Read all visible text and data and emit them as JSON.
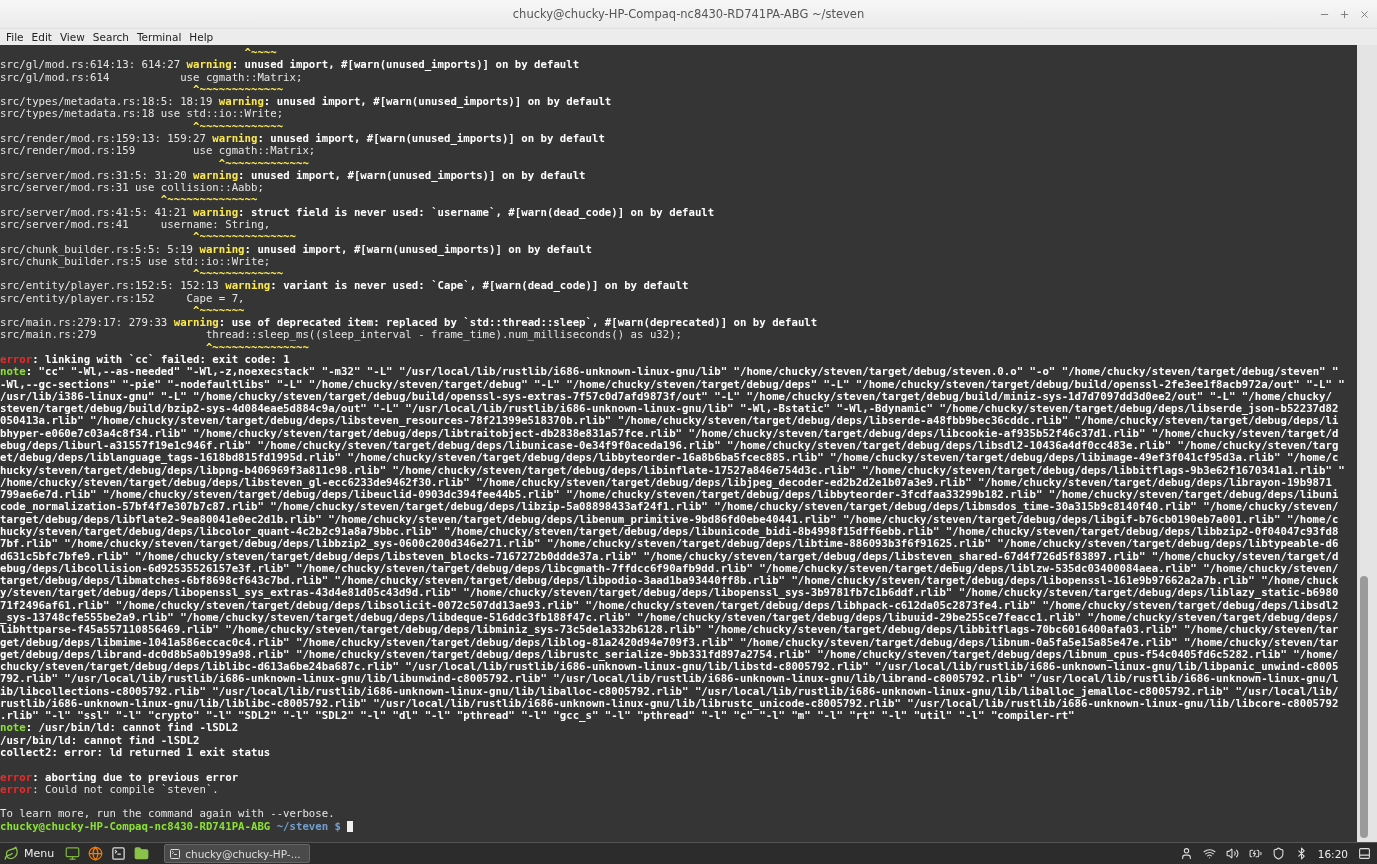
{
  "window": {
    "title": "chucky@chucky-HP-Compaq-nc8430-RD741PA-ABG ~/steven"
  },
  "menu_bar": [
    "File",
    "Edit",
    "View",
    "Search",
    "Terminal",
    "Help"
  ],
  "terminal": {
    "lines": [
      {
        "kind": "text",
        "segments": [
          {
            "kind": "caret",
            "text": "                                      ^~~~~"
          }
        ]
      },
      {
        "kind": "text",
        "segments": [
          {
            "kind": "plain",
            "text": "src/gl/mod.rs:614:13: 614:27 "
          },
          {
            "kind": "warning",
            "text": "warning"
          },
          {
            "kind": "bold",
            "text": ": unused import, #[warn(unused_imports)] on by default"
          }
        ]
      },
      {
        "kind": "text",
        "segments": [
          {
            "kind": "plain",
            "text": "src/gl/mod.rs:614           use cgmath::Matrix;"
          }
        ]
      },
      {
        "kind": "text",
        "segments": [
          {
            "kind": "caret",
            "text": "                              ^~~~~~~~~~~~~~"
          }
        ]
      },
      {
        "kind": "text",
        "segments": [
          {
            "kind": "plain",
            "text": "src/types/metadata.rs:18:5: 18:19 "
          },
          {
            "kind": "warning",
            "text": "warning"
          },
          {
            "kind": "bold",
            "text": ": unused import, #[warn(unused_imports)] on by default"
          }
        ]
      },
      {
        "kind": "text",
        "segments": [
          {
            "kind": "plain",
            "text": "src/types/metadata.rs:18 use std::io::Write;"
          }
        ]
      },
      {
        "kind": "text",
        "segments": [
          {
            "kind": "caret",
            "text": "                              ^~~~~~~~~~~~~~"
          }
        ]
      },
      {
        "kind": "text",
        "segments": [
          {
            "kind": "plain",
            "text": "src/render/mod.rs:159:13: 159:27 "
          },
          {
            "kind": "warning",
            "text": "warning"
          },
          {
            "kind": "bold",
            "text": ": unused import, #[warn(unused_imports)] on by default"
          }
        ]
      },
      {
        "kind": "text",
        "segments": [
          {
            "kind": "plain",
            "text": "src/render/mod.rs:159         use cgmath::Matrix;"
          }
        ]
      },
      {
        "kind": "text",
        "segments": [
          {
            "kind": "caret",
            "text": "                                  ^~~~~~~~~~~~~~"
          }
        ]
      },
      {
        "kind": "text",
        "segments": [
          {
            "kind": "plain",
            "text": "src/server/mod.rs:31:5: 31:20 "
          },
          {
            "kind": "warning",
            "text": "warning"
          },
          {
            "kind": "bold",
            "text": ": unused import, #[warn(unused_imports)] on by default"
          }
        ]
      },
      {
        "kind": "text",
        "segments": [
          {
            "kind": "plain",
            "text": "src/server/mod.rs:31 use collision::Aabb;"
          }
        ]
      },
      {
        "kind": "text",
        "segments": [
          {
            "kind": "caret",
            "text": "                         ^~~~~~~~~~~~~~~"
          }
        ]
      },
      {
        "kind": "text",
        "segments": [
          {
            "kind": "plain",
            "text": "src/server/mod.rs:41:5: 41:21 "
          },
          {
            "kind": "warning",
            "text": "warning"
          },
          {
            "kind": "bold",
            "text": ": struct field is never used: `username`, #[warn(dead_code)] on by default"
          }
        ]
      },
      {
        "kind": "text",
        "segments": [
          {
            "kind": "plain",
            "text": "src/server/mod.rs:41     username: String,"
          }
        ]
      },
      {
        "kind": "text",
        "segments": [
          {
            "kind": "caret",
            "text": "                              ^~~~~~~~~~~~~~~~"
          }
        ]
      },
      {
        "kind": "text",
        "segments": [
          {
            "kind": "plain",
            "text": "src/chunk_builder.rs:5:5: 5:19 "
          },
          {
            "kind": "warning",
            "text": "warning"
          },
          {
            "kind": "bold",
            "text": ": unused import, #[warn(unused_imports)] on by default"
          }
        ]
      },
      {
        "kind": "text",
        "segments": [
          {
            "kind": "plain",
            "text": "src/chunk_builder.rs:5 use std::io::Write;"
          }
        ]
      },
      {
        "kind": "text",
        "segments": [
          {
            "kind": "caret",
            "text": "                              ^~~~~~~~~~~~~~"
          }
        ]
      },
      {
        "kind": "text",
        "segments": [
          {
            "kind": "plain",
            "text": "src/entity/player.rs:152:5: 152:13 "
          },
          {
            "kind": "warning",
            "text": "warning"
          },
          {
            "kind": "bold",
            "text": ": variant is never used: `Cape`, #[warn(dead_code)] on by default"
          }
        ]
      },
      {
        "kind": "text",
        "segments": [
          {
            "kind": "plain",
            "text": "src/entity/player.rs:152     Cape = 7,"
          }
        ]
      },
      {
        "kind": "text",
        "segments": [
          {
            "kind": "caret",
            "text": "                              ^~~~~~~~"
          }
        ]
      },
      {
        "kind": "text",
        "segments": [
          {
            "kind": "plain",
            "text": "src/main.rs:279:17: 279:33 "
          },
          {
            "kind": "warning",
            "text": "warning"
          },
          {
            "kind": "bold",
            "text": ": use of deprecated item: replaced by `std::thread::sleep`, #[warn(deprecated)] on by default"
          }
        ]
      },
      {
        "kind": "text",
        "segments": [
          {
            "kind": "plain",
            "text": "src/main.rs:279                 thread::sleep_ms((sleep_interval - frame_time).num_milliseconds() as u32);"
          }
        ]
      },
      {
        "kind": "text",
        "segments": [
          {
            "kind": "caret",
            "text": "                                ^~~~~~~~~~~~~~~~"
          }
        ]
      },
      {
        "kind": "text",
        "segments": [
          {
            "kind": "error",
            "text": "error"
          },
          {
            "kind": "bold",
            "text": ": linking with `cc` failed: exit code: 1"
          }
        ]
      },
      {
        "kind": "text",
        "segments": [
          {
            "kind": "note",
            "text": "note"
          },
          {
            "kind": "bold",
            "text": ": \"cc\" \"-Wl,--as-needed\" \"-Wl,-z,noexecstack\" \"-m32\" \"-L\" \"/usr/local/lib/rustlib/i686-unknown-linux-gnu/lib\" \"/home/chucky/steven/target/debug/steven.0.o\" \"-o\" \"/home/chucky/steven/target/debug/steven\" \""
          }
        ]
      },
      {
        "kind": "text",
        "segments": [
          {
            "kind": "bold",
            "text": "-Wl,--gc-sections\" \"-pie\" \"-nodefaultlibs\" \"-L\" \"/home/chucky/steven/target/debug\" \"-L\" \"/home/chucky/steven/target/debug/deps\" \"-L\" \"/home/chucky/steven/target/debug/build/openssl-2fe3ee1f8acb972a/out\" \"-L\" \""
          }
        ]
      },
      {
        "kind": "text",
        "segments": [
          {
            "kind": "bold",
            "text": "/usr/lib/i386-linux-gnu\" \"-L\" \"/home/chucky/steven/target/debug/build/openssl-sys-extras-7f57c0d7afd9873f/out\" \"-L\" \"/home/chucky/steven/target/debug/build/miniz-sys-1d7d7097dd3d0ee2/out\" \"-L\" \"/home/chucky/"
          }
        ]
      },
      {
        "kind": "text",
        "segments": [
          {
            "kind": "bold",
            "text": "steven/target/debug/build/bzip2-sys-4d084eae5d884c9a/out\" \"-L\" \"/usr/local/lib/rustlib/i686-unknown-linux-gnu/lib\" \"-Wl,-Bstatic\" \"-Wl,-Bdynamic\" \"/home/chucky/steven/target/debug/deps/libserde_json-b52237d82"
          }
        ]
      },
      {
        "kind": "text",
        "segments": [
          {
            "kind": "bold",
            "text": "050413a.rlib\" \"/home/chucky/steven/target/debug/deps/libsteven_resources-78f21399e518370b.rlib\" \"/home/chucky/steven/target/debug/deps/libserde-a48fbb9bec36cddc.rlib\" \"/home/chucky/steven/target/debug/deps/li"
          }
        ]
      },
      {
        "kind": "text",
        "segments": [
          {
            "kind": "bold",
            "text": "bhyper-e060e7c03a4c8f34.rlib\" \"/home/chucky/steven/target/debug/deps/libtraitobject-db2838e831a57fce.rlib\" \"/home/chucky/steven/target/debug/deps/libcookie-af935b52f46c37d1.rlib\" \"/home/chucky/steven/target/d"
          }
        ]
      },
      {
        "kind": "text",
        "segments": [
          {
            "kind": "bold",
            "text": "ebug/deps/liburl-a31557f19e1c946f.rlib\" \"/home/chucky/steven/target/debug/deps/libunicase-0e34f9f0aceda196.rlib\" \"/home/chucky/steven/target/debug/deps/libsdl2-10436a4df0cc483e.rlib\" \"/home/chucky/steven/targ"
          }
        ]
      },
      {
        "kind": "text",
        "segments": [
          {
            "kind": "bold",
            "text": "et/debug/deps/liblanguage_tags-1618bd815fd1995d.rlib\" \"/home/chucky/steven/target/debug/deps/libbyteorder-16a8b6ba5fcec885.rlib\" \"/home/chucky/steven/target/debug/deps/libimage-49ef3f041cf95d3a.rlib\" \"/home/c"
          }
        ]
      },
      {
        "kind": "text",
        "segments": [
          {
            "kind": "bold",
            "text": "hucky/steven/target/debug/deps/libpng-b406969f3a811c98.rlib\" \"/home/chucky/steven/target/debug/deps/libinflate-17527a846e754d3c.rlib\" \"/home/chucky/steven/target/debug/deps/libbitflags-9b3e62f1670341a1.rlib\" \""
          }
        ]
      },
      {
        "kind": "text",
        "segments": [
          {
            "kind": "bold",
            "text": "/home/chucky/steven/target/debug/deps/libsteven_gl-ecc6233de9462f30.rlib\" \"/home/chucky/steven/target/debug/deps/libjpeg_decoder-ed2b2d2e1b07a3e9.rlib\" \"/home/chucky/steven/target/debug/deps/librayon-19b9871"
          }
        ]
      },
      {
        "kind": "text",
        "segments": [
          {
            "kind": "bold",
            "text": "799ae6e7d.rlib\" \"/home/chucky/steven/target/debug/deps/libeuclid-0903dc394fee44b5.rlib\" \"/home/chucky/steven/target/debug/deps/libbyteorder-3fcdfaa33299b182.rlib\" \"/home/chucky/steven/target/debug/deps/libuni"
          }
        ]
      },
      {
        "kind": "text",
        "segments": [
          {
            "kind": "bold",
            "text": "code_normalization-57bf4f7e307b7c87.rlib\" \"/home/chucky/steven/target/debug/deps/libzip-5a08898433af24f1.rlib\" \"/home/chucky/steven/target/debug/deps/libmsdos_time-30a315b9c8140f40.rlib\" \"/home/chucky/steven/"
          }
        ]
      },
      {
        "kind": "text",
        "segments": [
          {
            "kind": "bold",
            "text": "target/debug/deps/libflate2-9ea80041e0ec2d1b.rlib\" \"/home/chucky/steven/target/debug/deps/libenum_primitive-9bd86fd0ebe40441.rlib\" \"/home/chucky/steven/target/debug/deps/libgif-b76cb0190eb7a001.rlib\" \"/home/c"
          }
        ]
      },
      {
        "kind": "text",
        "segments": [
          {
            "kind": "bold",
            "text": "hucky/steven/target/debug/deps/libcolor_quant-4c2b2c91a8a79bbc.rlib\" \"/home/chucky/steven/target/debug/deps/libunicode_bidi-8b4998f15dff6ebb.rlib\" \"/home/chucky/steven/target/debug/deps/libbzip2-0f04047c93fd8"
          }
        ]
      },
      {
        "kind": "text",
        "segments": [
          {
            "kind": "bold",
            "text": "7bf.rlib\" \"/home/chucky/steven/target/debug/deps/libbzip2_sys-0600c200d346e271.rlib\" \"/home/chucky/steven/target/debug/deps/libtime-886093b3f6f91625.rlib\" \"/home/chucky/steven/target/debug/deps/libtypeable-d6"
          }
        ]
      },
      {
        "kind": "text",
        "segments": [
          {
            "kind": "bold",
            "text": "d631c5bfc7bfe9.rlib\" \"/home/chucky/steven/target/debug/deps/libsteven_blocks-7167272b0ddde37a.rlib\" \"/home/chucky/steven/target/debug/deps/libsteven_shared-67d4f726d5f83897.rlib\" \"/home/chucky/steven/target/d"
          }
        ]
      },
      {
        "kind": "text",
        "segments": [
          {
            "kind": "bold",
            "text": "ebug/deps/libcollision-6d92535526157e3f.rlib\" \"/home/chucky/steven/target/debug/deps/libcgmath-7ffdcc6f90afb9dd.rlib\" \"/home/chucky/steven/target/debug/deps/liblzw-535dc03400084aea.rlib\" \"/home/chucky/steven/"
          }
        ]
      },
      {
        "kind": "text",
        "segments": [
          {
            "kind": "bold",
            "text": "target/debug/deps/libmatches-6bf8698cf643c7bd.rlib\" \"/home/chucky/steven/target/debug/deps/libpodio-3aad1ba93440ff8b.rlib\" \"/home/chucky/steven/target/debug/deps/libopenssl-161e9b97662a2a7b.rlib\" \"/home/chuck"
          }
        ]
      },
      {
        "kind": "text",
        "segments": [
          {
            "kind": "bold",
            "text": "y/steven/target/debug/deps/libopenssl_sys_extras-43d4e81d05c43d9d.rlib\" \"/home/chucky/steven/target/debug/deps/libopenssl_sys-3b9781fb7c1b6ddf.rlib\" \"/home/chucky/steven/target/debug/deps/liblazy_static-b6980"
          }
        ]
      },
      {
        "kind": "text",
        "segments": [
          {
            "kind": "bold",
            "text": "71f2496af61.rlib\" \"/home/chucky/steven/target/debug/deps/libsolicit-0072c507dd13ae93.rlib\" \"/home/chucky/steven/target/debug/deps/libhpack-c612da05c2873fe4.rlib\" \"/home/chucky/steven/target/debug/deps/libsdl2"
          }
        ]
      },
      {
        "kind": "text",
        "segments": [
          {
            "kind": "bold",
            "text": "_sys-13748cfe555be2a9.rlib\" \"/home/chucky/steven/target/debug/deps/libdeque-516ddc3fb188f47c.rlib\" \"/home/chucky/steven/target/debug/deps/libuuid-29be255ce7feacc1.rlib\" \"/home/chucky/steven/target/debug/deps/"
          }
        ]
      },
      {
        "kind": "text",
        "segments": [
          {
            "kind": "bold",
            "text": "libhttparse-f45a557110856469.rlib\" \"/home/chucky/steven/target/debug/deps/libminiz_sys-73c5de1a332b6128.rlib\" \"/home/chucky/steven/target/debug/deps/libbitflags-70bc6016400afa03.rlib\" \"/home/chucky/steven/tar"
          }
        ]
      },
      {
        "kind": "text",
        "segments": [
          {
            "kind": "bold",
            "text": "get/debug/deps/libmime-1041a586eccac0c4.rlib\" \"/home/chucky/steven/target/debug/deps/liblog-81a2420d94e709f3.rlib\" \"/home/chucky/steven/target/debug/deps/libnum-0a5fa5e15a85e47e.rlib\" \"/home/chucky/steven/tar"
          }
        ]
      },
      {
        "kind": "text",
        "segments": [
          {
            "kind": "bold",
            "text": "get/debug/deps/librand-dc0d8b5a0b199a98.rlib\" \"/home/chucky/steven/target/debug/deps/librustc_serialize-9bb331fd897a2754.rlib\" \"/home/chucky/steven/target/debug/deps/libnum_cpus-f54c0405fd6c5282.rlib\" \"/home/"
          }
        ]
      },
      {
        "kind": "text",
        "segments": [
          {
            "kind": "bold",
            "text": "chucky/steven/target/debug/deps/liblibc-d613a6be24ba687c.rlib\" \"/usr/local/lib/rustlib/i686-unknown-linux-gnu/lib/libstd-c8005792.rlib\" \"/usr/local/lib/rustlib/i686-unknown-linux-gnu/lib/libpanic_unwind-c8005"
          }
        ]
      },
      {
        "kind": "text",
        "segments": [
          {
            "kind": "bold",
            "text": "792.rlib\" \"/usr/local/lib/rustlib/i686-unknown-linux-gnu/lib/libunwind-c8005792.rlib\" \"/usr/local/lib/rustlib/i686-unknown-linux-gnu/lib/librand-c8005792.rlib\" \"/usr/local/lib/rustlib/i686-unknown-linux-gnu/l"
          }
        ]
      },
      {
        "kind": "text",
        "segments": [
          {
            "kind": "bold",
            "text": "ib/libcollections-c8005792.rlib\" \"/usr/local/lib/rustlib/i686-unknown-linux-gnu/lib/liballoc-c8005792.rlib\" \"/usr/local/lib/rustlib/i686-unknown-linux-gnu/lib/liballoc_jemalloc-c8005792.rlib\" \"/usr/local/lib/"
          }
        ]
      },
      {
        "kind": "text",
        "segments": [
          {
            "kind": "bold",
            "text": "rustlib/i686-unknown-linux-gnu/lib/liblibc-c8005792.rlib\" \"/usr/local/lib/rustlib/i686-unknown-linux-gnu/lib/librustc_unicode-c8005792.rlib\" \"/usr/local/lib/rustlib/i686-unknown-linux-gnu/lib/libcore-c8005792"
          }
        ]
      },
      {
        "kind": "text",
        "segments": [
          {
            "kind": "bold",
            "text": ".rlib\" \"-l\" \"ssl\" \"-l\" \"crypto\" \"-l\" \"SDL2\" \"-l\" \"SDL2\" \"-l\" \"dl\" \"-l\" \"pthread\" \"-l\" \"gcc_s\" \"-l\" \"pthread\" \"-l\" \"c\" \"-l\" \"m\" \"-l\" \"rt\" \"-l\" \"util\" \"-l\" \"compiler-rt\""
          }
        ]
      },
      {
        "kind": "text",
        "segments": [
          {
            "kind": "note",
            "text": "note"
          },
          {
            "kind": "bold",
            "text": ": /usr/bin/ld: cannot find -lSDL2"
          }
        ]
      },
      {
        "kind": "text",
        "segments": [
          {
            "kind": "bold",
            "text": "/usr/bin/ld: cannot find -lSDL2"
          }
        ]
      },
      {
        "kind": "text",
        "segments": [
          {
            "kind": "bold",
            "text": "collect2: error: ld returned 1 exit status"
          }
        ]
      },
      {
        "kind": "blank"
      },
      {
        "kind": "text",
        "segments": [
          {
            "kind": "error",
            "text": "error"
          },
          {
            "kind": "bold",
            "text": ": aborting due to previous error"
          }
        ]
      },
      {
        "kind": "text",
        "segments": [
          {
            "kind": "error",
            "text": "error"
          },
          {
            "kind": "plain",
            "text": ": Could not compile `steven`."
          }
        ]
      },
      {
        "kind": "blank"
      },
      {
        "kind": "text",
        "segments": [
          {
            "kind": "plain",
            "text": "To learn more, run the command again with --verbose."
          }
        ]
      },
      {
        "kind": "text",
        "cursor": true,
        "segments": [
          {
            "kind": "user",
            "text": "chucky@chucky-HP-Compaq-nc8430-RD741PA-ABG"
          },
          {
            "kind": "path",
            "text": " ~/steven $ "
          }
        ]
      }
    ]
  },
  "taskbar": {
    "menu_label": "Menu",
    "tasks": [
      {
        "label": "chucky@chucky-HP-...",
        "selected": true
      }
    ],
    "clock": "16:20"
  }
}
